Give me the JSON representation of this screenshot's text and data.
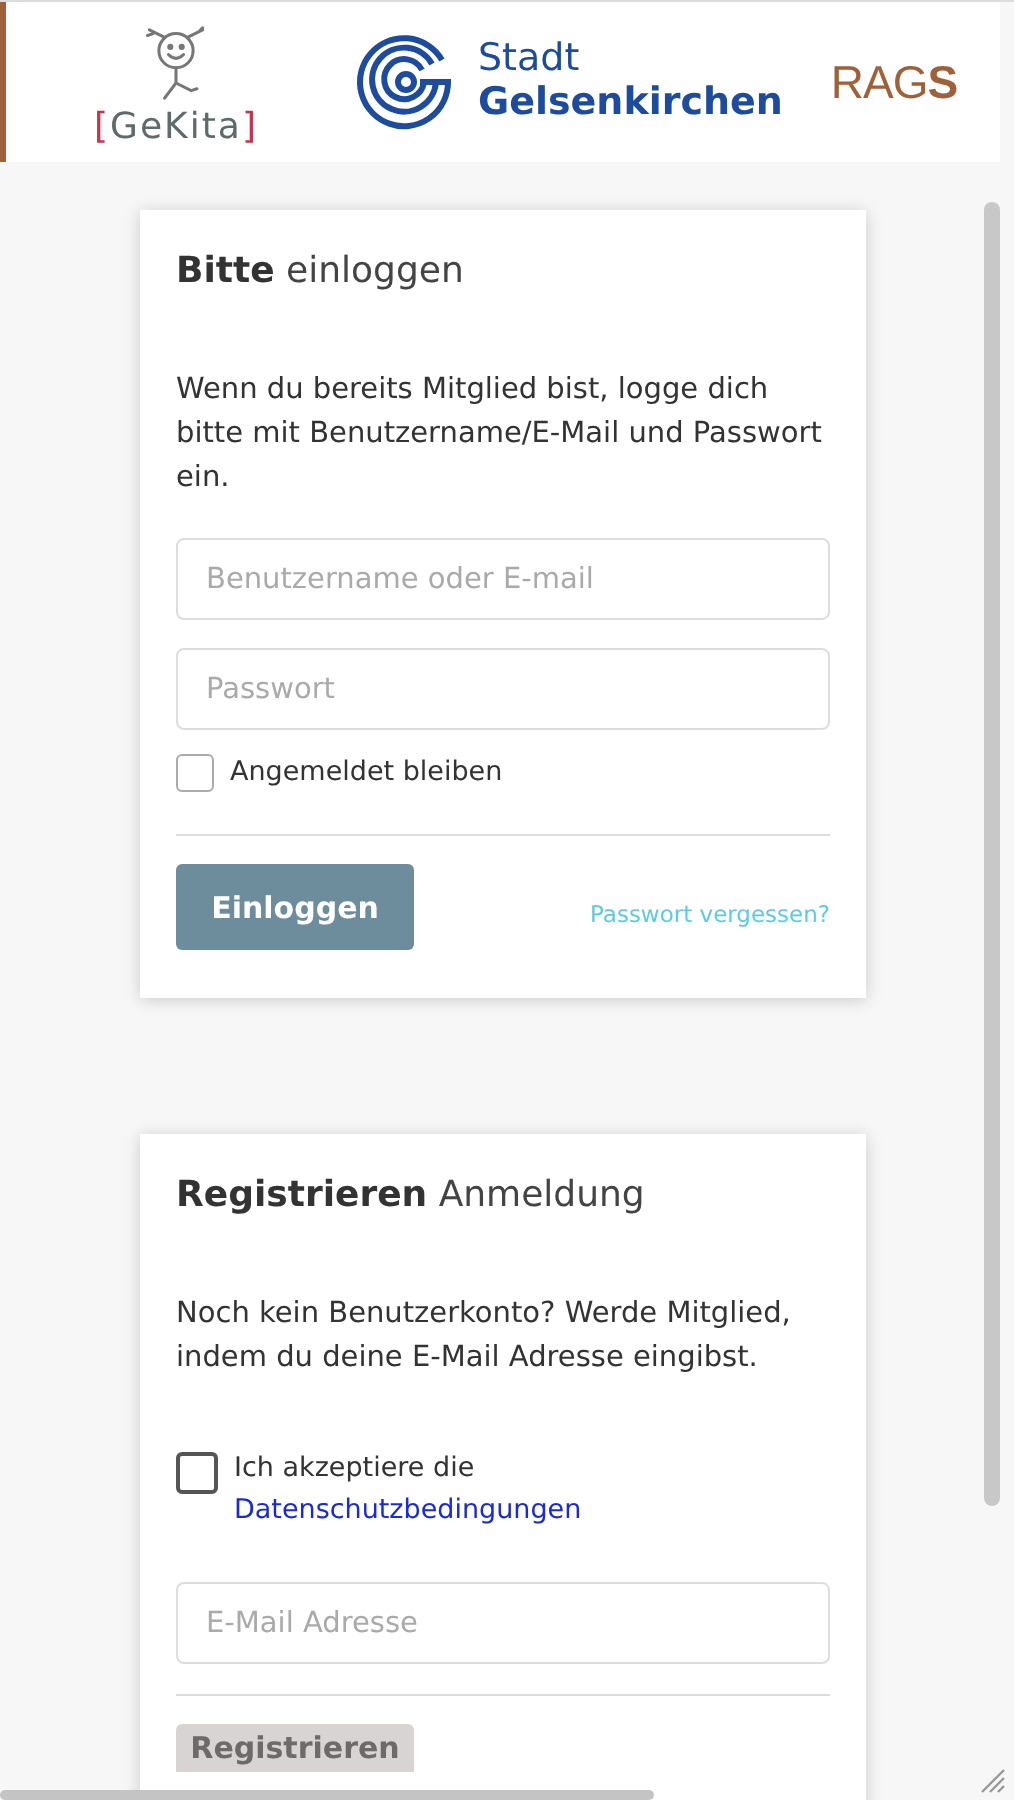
{
  "header": {
    "logos": [
      {
        "kind": "gekita",
        "text": "[GeKita]"
      },
      {
        "kind": "city",
        "lines": [
          "Stadt",
          "Gelsenkirchen"
        ]
      },
      {
        "kind": "rag",
        "text": "RAG**S**"
      }
    ]
  },
  "login": {
    "title": "**Bitte** einloggen",
    "intro": "Wenn du bereits Mitglied bist, logge dich bitte mit Benutzername/E-Mail und Passwort ein.",
    "fields": [
      {
        "placeholder": "Benutzername oder E-mail"
      },
      {
        "placeholder": "Passwort"
      }
    ],
    "remember": {
      "label": "Angemeldet bleiben",
      "checked": false
    },
    "button": {
      "label": "Einloggen",
      "disabled": false
    },
    "link": "Passwort vergessen?"
  },
  "register": {
    "title": "**Registrieren** Anmeldung",
    "intro": "Noch kein Benutzerkonto? Werde Mitglied, indem du deine E-Mail Adresse eingibst.",
    "consent": {
      "label": "Ich akzeptiere die",
      "link": "Datenschutzbedingungen",
      "checked": false
    },
    "fields": [
      {
        "placeholder": "E-Mail Adresse"
      }
    ],
    "button": {
      "label": "Registrieren",
      "disabled": true
    }
  }
}
